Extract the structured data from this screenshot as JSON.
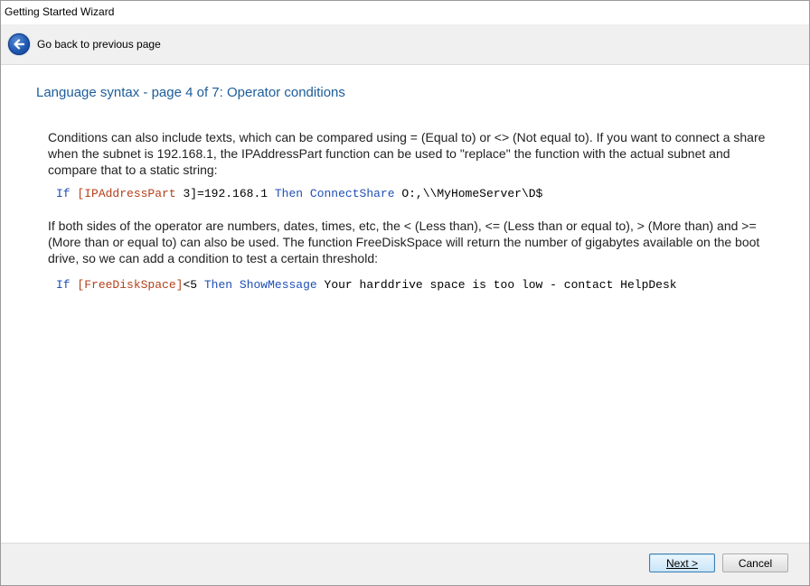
{
  "window": {
    "title": "Getting Started Wizard"
  },
  "nav": {
    "back_label": "Go back to previous page"
  },
  "page": {
    "title": "Language syntax - page 4 of 7: Operator conditions",
    "paragraph1": "Conditions can also include texts, which can be compared using = (Equal to) or <> (Not equal to). If you want to connect a share when the subnet is 192.168.1, the IPAddressPart function can be used to \"replace\" the function with the actual subnet and compare that to a static string:",
    "code1": {
      "if": "If",
      "fn": "[IPAddressPart",
      "arg": " 3]",
      "rest": "=192.168.1 ",
      "then": "Then",
      "cmd": "ConnectShare",
      "params": " O:,\\\\MyHomeServer\\D$"
    },
    "paragraph2": "If both sides of the operator are numbers, dates, times, etc, the < (Less than), <= (Less than or equal to), > (More than) and >= (More than or equal to) can also be used. The function FreeDiskSpace will return the number of gigabytes available on the boot drive, so we can add a condition to test a certain threshold:",
    "code2": {
      "if": "If",
      "fn": "[FreeDiskSpace]",
      "rest": "<5 ",
      "then": "Then",
      "cmd": "ShowMessage",
      "params": " Your harddrive space is too low - contact HelpDesk"
    }
  },
  "footer": {
    "next_label": "Next >",
    "cancel_label": "Cancel"
  },
  "colors": {
    "title_blue": "#1c5d9a",
    "keyword_blue": "#1f4fb5",
    "function_red": "#b3401a"
  }
}
